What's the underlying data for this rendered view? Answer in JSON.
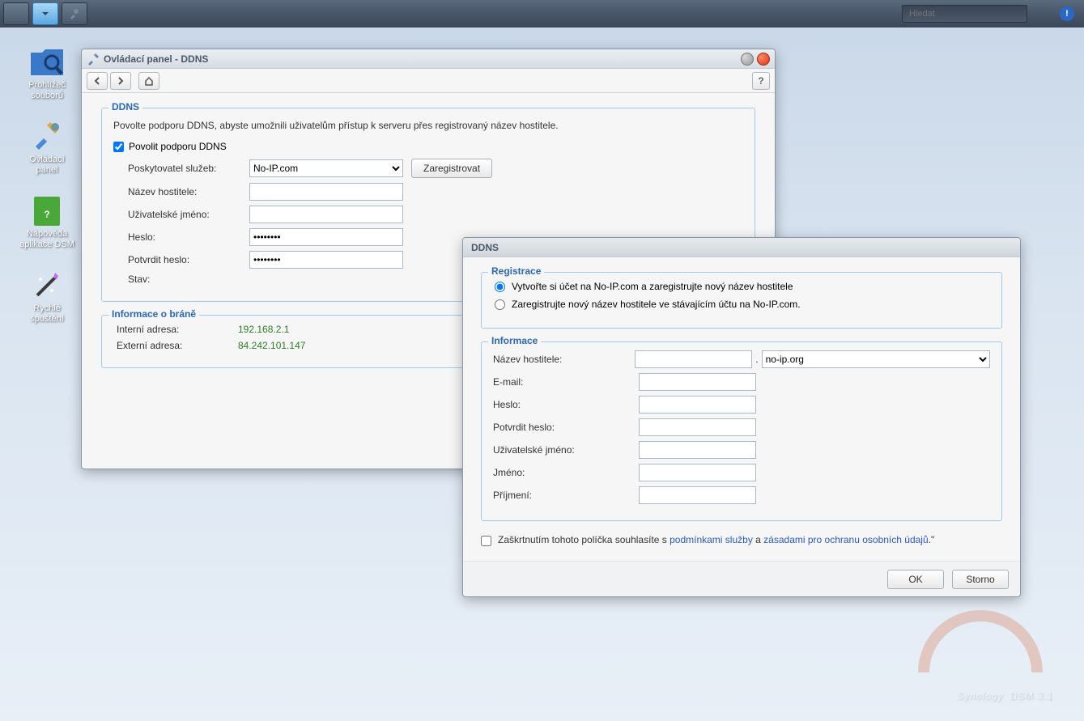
{
  "taskbar": {
    "search_placeholder": "Hledat"
  },
  "desktop": {
    "items": [
      {
        "label": "Prohlížeč\nsouborů",
        "icon": "folder-search"
      },
      {
        "label": "Ovládací\npanel",
        "icon": "tools"
      },
      {
        "label": "Nápověda\naplikace DSM",
        "icon": "help-book"
      },
      {
        "label": "Rychlé\nspuštění",
        "icon": "wand"
      }
    ]
  },
  "win1": {
    "title": "Ovládací panel - DDNS",
    "section_ddns": {
      "legend": "DDNS",
      "desc": "Povolte podporu DDNS, abyste umožnili uživatelům přístup k serveru přes registrovaný název hostitele.",
      "enable_label": "Povolit podporu DDNS",
      "enable_checked": true,
      "provider_label": "Poskytovatel služeb:",
      "provider_value": "No-IP.com",
      "register_btn": "Zaregistrovat",
      "hostname_label": "Název hostitele:",
      "hostname_value": "",
      "username_label": "Uživatelské jméno:",
      "username_value": "",
      "password_label": "Heslo:",
      "password_value": "••••••••",
      "confirm_label": "Potvrdit heslo:",
      "confirm_value": "••••••••",
      "status_label": "Stav:"
    },
    "section_gw": {
      "legend": "Informace o bráně",
      "internal_label": "Interní adresa:",
      "internal_value": "192.168.2.1",
      "external_label": "Externí adresa:",
      "external_value": "84.242.101.147"
    }
  },
  "win2": {
    "title": "DDNS",
    "reg": {
      "legend": "Registrace",
      "opt1": "Vytvořte si účet na No-IP.com a zaregistrujte nový název hostitele",
      "opt2": "Zaregistrujte nový název hostitele ve stávajícím účtu na No-IP.com.",
      "selected": 0
    },
    "info": {
      "legend": "Informace",
      "hostname_label": "Název hostitele:",
      "hostname_value": "",
      "domain_value": "no-ip.org",
      "email_label": "E-mail:",
      "password_label": "Heslo:",
      "confirm_label": "Potvrdit heslo:",
      "username_label": "Uživatelské jméno:",
      "firstname_label": "Jméno:",
      "lastname_label": "Příjmení:"
    },
    "agree": {
      "checked": false,
      "text1": "Zaškrtnutím tohoto políčka souhlasíte s ",
      "link1": "podmínkami služby",
      "text2": " a ",
      "link2": "zásadami pro ochranu osobních údajů",
      "text3": ".\""
    },
    "ok": "OK",
    "cancel": "Storno"
  },
  "brand": {
    "name": "Synology",
    "ver": "DSM 3.1"
  }
}
